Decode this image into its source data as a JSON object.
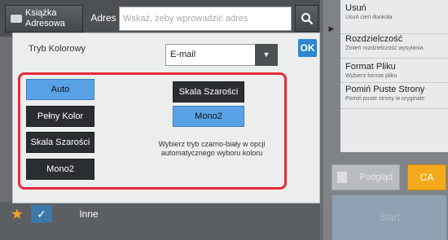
{
  "topbar": {
    "address_book_label": "Książka\nAdresowa",
    "address_label": "Adres",
    "address_placeholder": "Wskaż, żeby wprowadzić adres"
  },
  "dialog": {
    "title": "Tryb Kolorowy",
    "format_value": "E-mail",
    "ok_label": "OK",
    "left_options": [
      "Auto",
      "Pełny Kolor",
      "Skala Szarości",
      "Mono2"
    ],
    "right_options": [
      "Skala Szarości",
      "Mono2"
    ],
    "selected_left": "Auto",
    "selected_right": "Mono2",
    "info_text": "Wybierz tryb czarno-biały w opcji automatycznego wyboru koloru"
  },
  "right_menu": {
    "items": [
      {
        "title": "Usuń",
        "subtitle": "Usuń cień dookoła"
      },
      {
        "title": "Rozdzielczość",
        "subtitle": "Zmień rozdzielczość wysyłania"
      },
      {
        "title": "Format Pliku",
        "subtitle": "Wybierz format pliku"
      },
      {
        "title": "Pomiń Puste Strony",
        "subtitle": "Pomiń puste strony w oryginale"
      }
    ],
    "preview_label": "Podgląd",
    "ca_label": "CA",
    "start_label": "Start"
  },
  "bottombar": {
    "other_label": "Inne"
  },
  "colors": {
    "accent_selected": "#5aa2e6",
    "highlight_frame": "#e52b3a",
    "ok_blue": "#2d86cf",
    "ca_orange": "#f4a91d"
  }
}
